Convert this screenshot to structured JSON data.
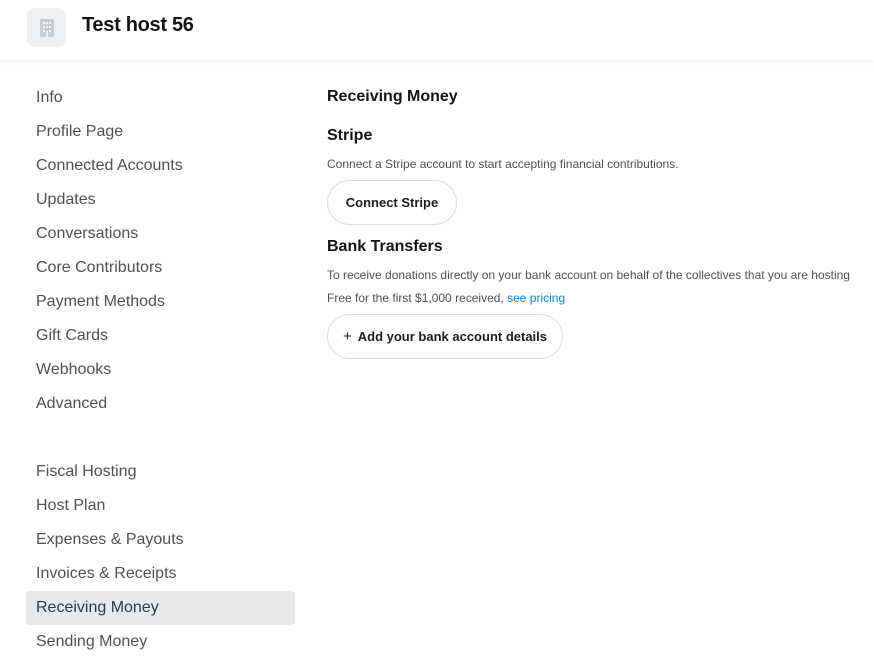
{
  "header": {
    "host_name": "Test host 56",
    "avatar_icon": "building-icon"
  },
  "sidebar": {
    "group1": [
      {
        "label": "Info"
      },
      {
        "label": "Profile Page"
      },
      {
        "label": "Connected Accounts"
      },
      {
        "label": "Updates"
      },
      {
        "label": "Conversations"
      },
      {
        "label": "Core Contributors"
      },
      {
        "label": "Payment Methods"
      },
      {
        "label": "Gift Cards"
      },
      {
        "label": "Webhooks"
      },
      {
        "label": "Advanced"
      }
    ],
    "group2": [
      {
        "label": "Fiscal Hosting"
      },
      {
        "label": "Host Plan"
      },
      {
        "label": "Expenses & Payouts"
      },
      {
        "label": "Invoices & Receipts"
      },
      {
        "label": "Receiving Money"
      },
      {
        "label": "Sending Money"
      }
    ],
    "active": "Receiving Money"
  },
  "main": {
    "title": "Receiving Money",
    "stripe": {
      "title": "Stripe",
      "description": "Connect a Stripe account to start accepting financial contributions.",
      "button": "Connect Stripe"
    },
    "bank": {
      "title": "Bank Transfers",
      "description": "To receive donations directly on your bank account on behalf of the collectives that you are hosting",
      "pricing_text": "Free for the first $1,000 received,",
      "pricing_link": "see pricing",
      "button_icon": "+",
      "button": "Add your bank account details"
    }
  },
  "colors": {
    "active_bg": "#e8e9ea",
    "active_text": "#1f3c57",
    "link": "#0a7fd6"
  }
}
